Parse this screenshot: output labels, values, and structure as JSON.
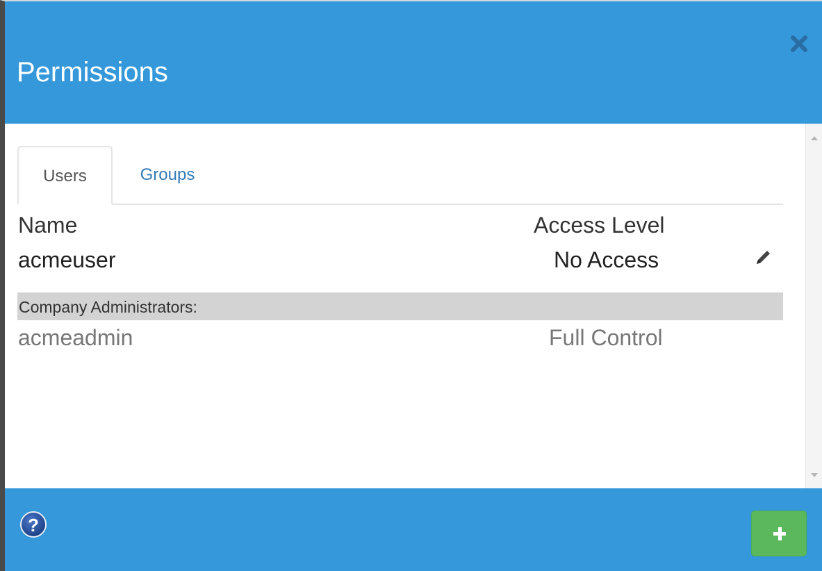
{
  "dialog": {
    "title": "Permissions"
  },
  "tabs": [
    {
      "label": "Users",
      "active": true
    },
    {
      "label": "Groups",
      "active": false
    }
  ],
  "columns": {
    "name": "Name",
    "access": "Access Level"
  },
  "users": [
    {
      "name": "acmeuser",
      "access": "No Access"
    }
  ],
  "group_section": {
    "label": "Company Administrators:",
    "members": [
      {
        "name": "acmeadmin",
        "access": "Full Control"
      }
    ]
  },
  "icons": {
    "close": "close-icon",
    "edit": "pencil-icon",
    "help": "help-icon",
    "add": "plus-icon"
  },
  "colors": {
    "accent": "#3498db",
    "add_button": "#5cb85c",
    "tab_link": "#337ab7",
    "group_band": "#d3d3d3"
  }
}
